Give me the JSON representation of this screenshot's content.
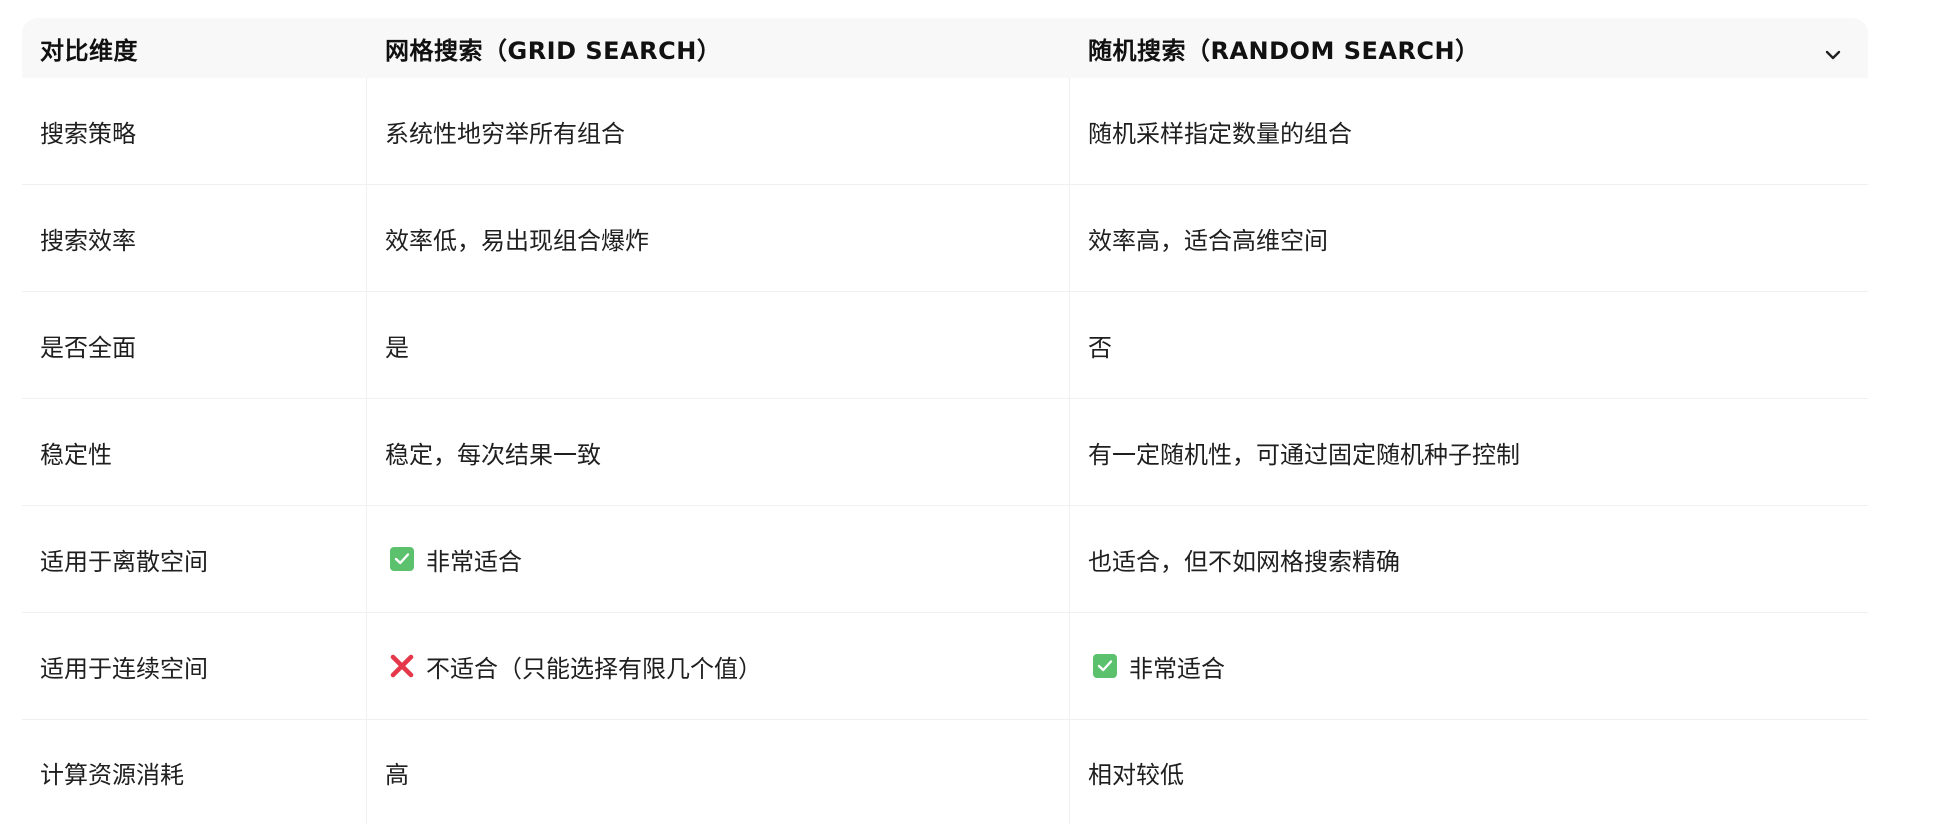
{
  "table": {
    "headers": [
      "对比维度",
      "网格搜索（GRID SEARCH）",
      "随机搜索（RANDOM SEARCH）"
    ],
    "rows": [
      {
        "dimension": "搜索策略",
        "grid": "系统性地穷举所有组合",
        "random": "随机采样指定数量的组合"
      },
      {
        "dimension": "搜索效率",
        "grid": "效率低，易出现组合爆炸",
        "random": "效率高，适合高维空间"
      },
      {
        "dimension": "是否全面",
        "grid": "是",
        "random": "否"
      },
      {
        "dimension": "稳定性",
        "grid": "稳定，每次结果一致",
        "random": "有一定随机性，可通过固定随机种子控制"
      },
      {
        "dimension": "适用于离散空间",
        "grid": "非常适合",
        "random": "也适合，但不如网格搜索精确"
      },
      {
        "dimension": "适用于连续空间",
        "grid": "不适合（只能选择有限几个值）",
        "random": "非常适合"
      },
      {
        "dimension": "计算资源消耗",
        "grid": "高",
        "random": "相对较低"
      }
    ]
  },
  "colors": {
    "check": "#5cc16d",
    "cross": "#e5394b",
    "header_bg": "#f8f8f8",
    "border": "#f0f0f0"
  },
  "icons": {
    "header_toggle": "chevron-down-icon",
    "yes": "check-icon",
    "no": "cross-icon"
  }
}
